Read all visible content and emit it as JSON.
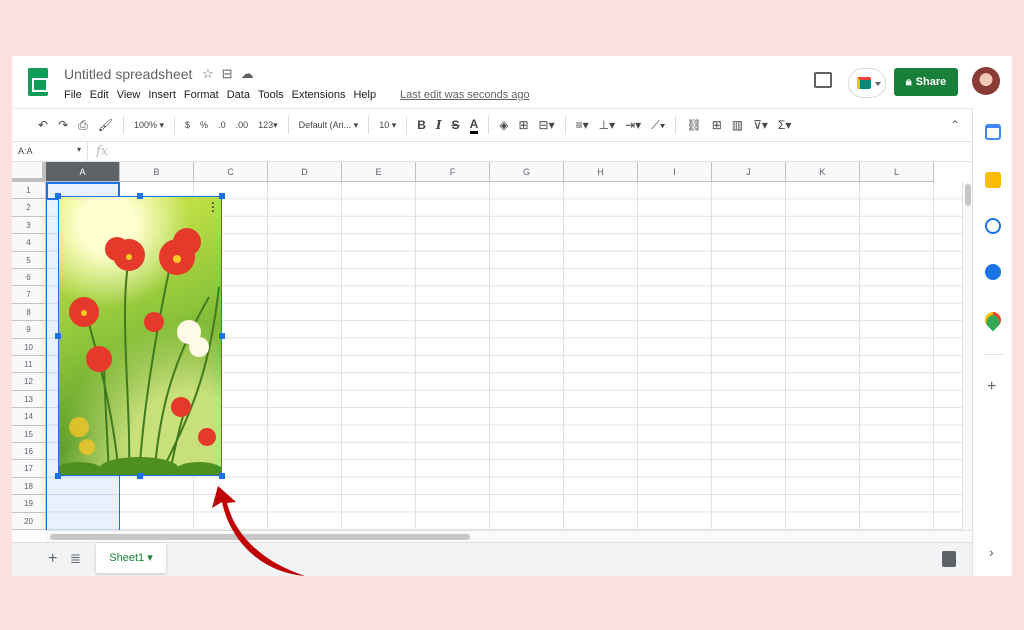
{
  "app": {
    "title": "Untitled spreadsheet",
    "last_edit": "Last edit was seconds ago",
    "share_label": "Share",
    "menus": [
      "File",
      "Edit",
      "View",
      "Insert",
      "Format",
      "Data",
      "Tools",
      "Extensions",
      "Help"
    ]
  },
  "toolbar": {
    "zoom": "100%",
    "currency": "$",
    "percent": "%",
    "decrease_decimal": ".0",
    "increase_decimal": ".00",
    "more_formats": "123",
    "font": "Default (Ari...",
    "font_size": "10",
    "bold": "B",
    "italic": "I",
    "strike": "S",
    "text_color": "A"
  },
  "formula_bar": {
    "name_box": "A:A",
    "fx": "fx"
  },
  "columns": [
    "A",
    "B",
    "C",
    "D",
    "E",
    "F",
    "G",
    "H",
    "I",
    "J",
    "K",
    "L"
  ],
  "rows": [
    "1",
    "2",
    "3",
    "4",
    "5",
    "6",
    "7",
    "8",
    "9",
    "10",
    "11",
    "12",
    "13",
    "14",
    "15",
    "16",
    "17",
    "18",
    "19",
    "20"
  ],
  "selected_column": "A",
  "sheet": {
    "tab_label": "Sheet1"
  },
  "colors": {
    "accent": "#1a73e8",
    "share": "#188038",
    "arrow": "#c00000"
  },
  "icons": [
    "sheets-logo",
    "star-icon",
    "move-icon",
    "cloud-icon",
    "comment-icon",
    "meet-icon",
    "lock-icon",
    "undo-icon",
    "redo-icon",
    "print-icon",
    "paint-format-icon",
    "calendar-icon",
    "keep-icon",
    "tasks-icon",
    "contacts-icon",
    "maps-icon",
    "plus-icon",
    "chevron-right-icon",
    "explore-icon"
  ]
}
